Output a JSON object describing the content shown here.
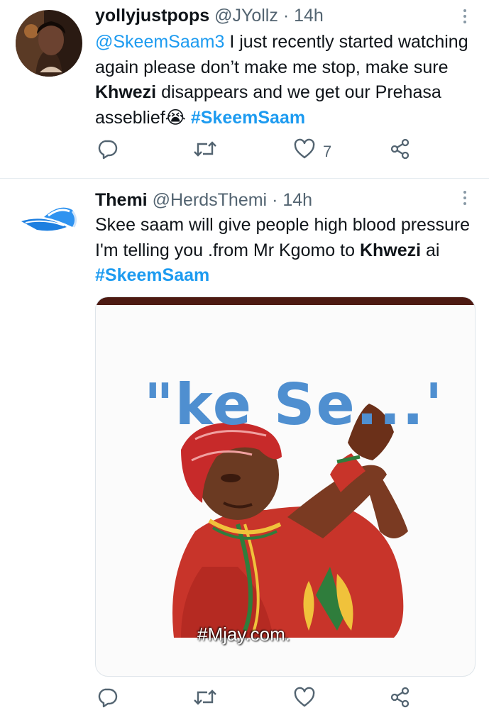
{
  "tweets": [
    {
      "name": "yollyjustpops",
      "handle": "@JYollz",
      "dot": "·",
      "time": "14h",
      "reply_to": "@SkeemSaam3",
      "text_1": " I just recently started watching again please don’t make me stop, make sure ",
      "bold_word": "Khwezi",
      "text_2": " disappears and we get our Prehasa asseblief",
      "emoji": "😭",
      "hashtag": "#SkeemSaam",
      "like_count": "7"
    },
    {
      "name": "Themi",
      "handle": "@HerdsThemi",
      "dot": "·",
      "time": "14h",
      "text_1": "Skee saam will give people high blood pressure I'm  telling you .from Mr Kgomo to ",
      "bold_word": "Khwezi",
      "text_2": " ai ",
      "hashtag": "#SkeemSaam",
      "media": {
        "caption": "\"ke Se...'",
        "watermark": "#Mjay.com."
      }
    }
  ],
  "icons": {
    "reply": "reply-icon",
    "retweet": "retweet-icon",
    "like": "like-icon",
    "share": "share-icon",
    "more": "more-vertical-icon"
  },
  "colors": {
    "accent": "#1d9bf0",
    "secondary_text": "#536471"
  }
}
